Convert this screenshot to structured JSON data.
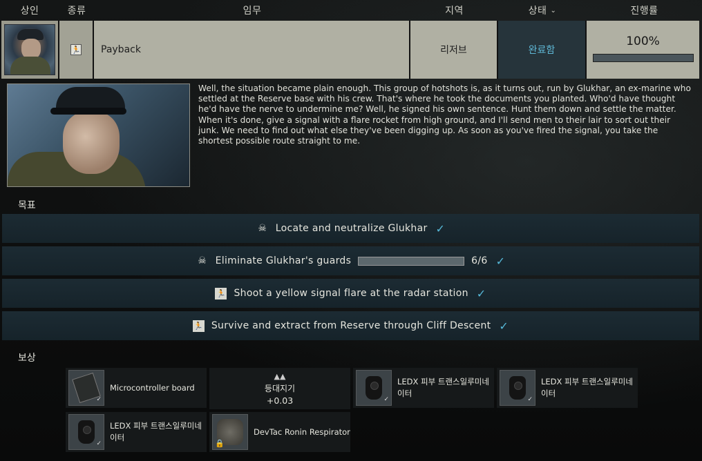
{
  "header": {
    "trader": "상인",
    "type": "종류",
    "task": "임무",
    "location": "지역",
    "status": "상태",
    "progress": "진행률"
  },
  "task_row": {
    "name": "Payback",
    "location": "리저브",
    "status": "완료함",
    "progress_text": "100%",
    "progress_fraction": 1.0
  },
  "description": "Well, the situation became plain enough. This group of hotshots is, as it turns out, run by Glukhar, an ex-marine who settled at the Reserve base with his crew. That's where he took the documents you planted. Who'd have thought he'd have the nerve to undermine me? Well, he signed his own sentence. Hunt them down and settle the matter. When it's done, give a signal with a flare rocket from high ground, and I'll send men to their lair to sort out their junk. We need to find out what else they've been digging up. As soon as you've fired the signal, you take the shortest possible route straight to me.",
  "objectives_label": "목표",
  "objectives": [
    {
      "icon": "skull-icon",
      "text": "Locate and neutralize Glukhar",
      "done": true
    },
    {
      "icon": "skull-icon",
      "text": "Eliminate Glukhar's guards",
      "count": "6/6",
      "progress_fraction": 1.0,
      "done": true
    },
    {
      "icon": "exit-icon",
      "text": "Shoot a yellow signal flare at the radar station",
      "done": true
    },
    {
      "icon": "exit-icon",
      "text": "Survive and extract from Reserve through Cliff Descent",
      "done": true
    }
  ],
  "rewards_label": "보상",
  "rewards": [
    {
      "name": "Microcontroller board",
      "icon": "microcontroller-board-icon"
    },
    {
      "name": "LEDX 피부 트랜스일루미네이터",
      "icon": "ledx-icon"
    },
    {
      "name": "LEDX 피부 트랜스일루미네이터",
      "icon": "ledx-icon"
    },
    {
      "name": "LEDX 피부 트랜스일루미네이터",
      "icon": "ledx-icon"
    },
    {
      "name": "DevTac Ronin Respirator",
      "icon": "respirator-icon",
      "locked": true
    }
  ],
  "reputation": {
    "label": "등대지기",
    "value": "+0.03",
    "icon": "reputation-icon"
  },
  "colors": {
    "status_text": "#5fb8d6",
    "check": "#56b8d8",
    "objective_bg": "#1c2b33",
    "row_bg": "#b0b0a3"
  }
}
